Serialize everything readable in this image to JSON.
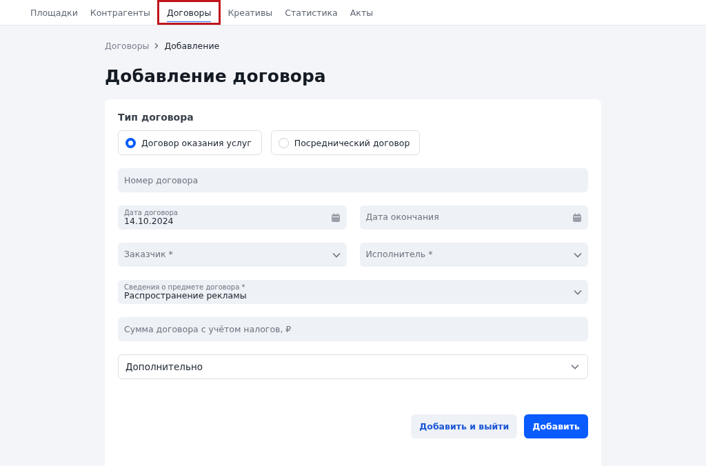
{
  "nav": {
    "tabs": [
      {
        "label": "Площадки",
        "selected": false,
        "highlighted": false
      },
      {
        "label": "Контрагенты",
        "selected": false,
        "highlighted": false
      },
      {
        "label": "Договоры",
        "selected": true,
        "highlighted": true
      },
      {
        "label": "Креативы",
        "selected": false,
        "highlighted": false
      },
      {
        "label": "Статистика",
        "selected": false,
        "highlighted": false
      },
      {
        "label": "Акты",
        "selected": false,
        "highlighted": false
      }
    ]
  },
  "breadcrumb": [
    "Договоры",
    "Добавление"
  ],
  "title": "Добавление договора",
  "form": {
    "type_label": "Тип договора",
    "contract_types": [
      {
        "label": "Договор оказания услуг",
        "selected": true
      },
      {
        "label": "Посреднический договор",
        "selected": false
      }
    ],
    "rows": [
      [
        {
          "kind": "text",
          "placeholder": "Номер договора"
        }
      ],
      [
        {
          "kind": "date",
          "label": "Дата договора",
          "value": "14.10.2024"
        },
        {
          "kind": "date",
          "placeholder": "Дата окончания"
        }
      ],
      [
        {
          "kind": "select",
          "placeholder": "Заказчик *"
        },
        {
          "kind": "select",
          "placeholder": "Исполнитель *"
        }
      ],
      [
        {
          "kind": "select",
          "label": "Сведения о предмете договора *",
          "value": "Распространение рекламы"
        }
      ],
      [
        {
          "kind": "text",
          "placeholder": "Сумма договора с учётом налогов, ₽"
        }
      ]
    ],
    "extra": {
      "label": "Дополнительно",
      "expanded": false
    },
    "buttons": [
      {
        "label": "Добавить и выйти",
        "kind": "secondary"
      },
      {
        "label": "Добавить",
        "kind": "primary"
      }
    ]
  }
}
